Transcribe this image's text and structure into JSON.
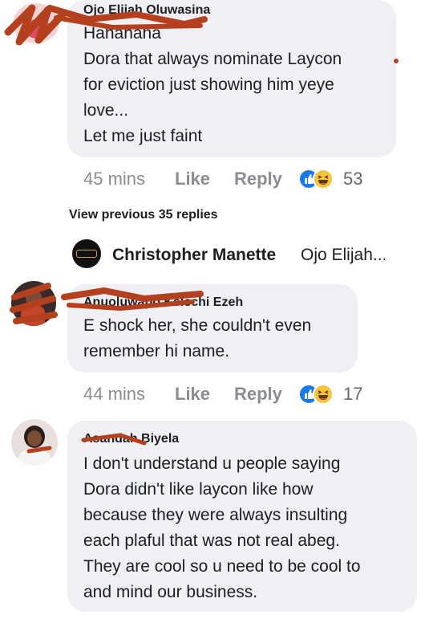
{
  "comments": [
    {
      "author": "Ojo Elijah Oluwasina",
      "lines": "Hahahaha\nDora that always nominate Laycon\nfor eviction just showing him yeye\nlove...\nLet me just faint",
      "time": "45 mins",
      "like": "Like",
      "reply": "Reply",
      "reactions": "53"
    },
    {
      "author": "Anuoluwapo Kelechi Ezeh",
      "lines": "E shock her, she couldn't even\nremember hi name.",
      "time": "44 mins",
      "like": "Like",
      "reply": "Reply",
      "reactions": "17"
    },
    {
      "author": "Asandah Biyela",
      "lines": "I don't understand u people saying\nDora didn't like laycon like how\nbecause they were always insulting\neach plaful that was not real abeg.\nThey are cool so u need to be cool to\nand mind our business.",
      "time": "",
      "like": "",
      "reply": "",
      "reactions": ""
    }
  ],
  "view_previous": "View previous 35 replies",
  "reply_preview": {
    "author": "Christopher Manette",
    "snippet": "Ojo Elijah..."
  },
  "colors": {
    "bubble": "#eef0f3",
    "like_blue": "#1877f2",
    "scribble": "#b5401e"
  },
  "icons": [
    "like-reaction-icon",
    "haha-reaction-icon"
  ]
}
